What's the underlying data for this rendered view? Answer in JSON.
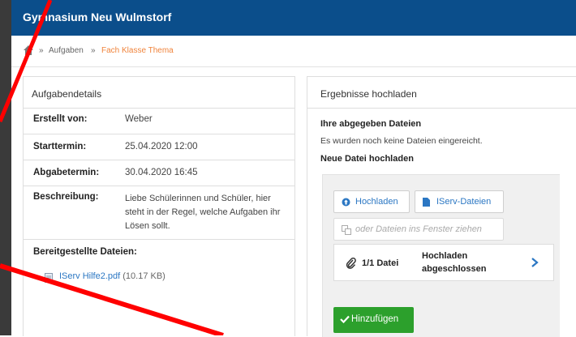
{
  "app": {
    "title": "Gymnasium Neu Wulmstorf"
  },
  "breadcrumb": {
    "sep1": "»",
    "item1": "Aufgaben",
    "sep2": "»",
    "current": "Fach Klasse Thema"
  },
  "details": {
    "heading": "Aufgabendetails",
    "rows": [
      {
        "label": "Erstellt von:",
        "value": "Weber"
      },
      {
        "label": "Starttermin:",
        "value": "25.04.2020 12:00"
      },
      {
        "label": "Abgabetermin:",
        "value": "30.04.2020 16:45"
      },
      {
        "label": "Beschreibung:",
        "value": "Liebe Schülerinnen und Schüler, hier steht in der Regel, welche Aufgaben ihr Lösen sollt."
      }
    ],
    "files_label": "Bereitgestellte Dateien:",
    "file_name": "IServ Hilfe2.pdf",
    "file_size": "(10.17 KB)"
  },
  "upload": {
    "heading": "Ergebnisse hochladen",
    "submitted_label": "Ihre abgegeben Dateien",
    "submitted_text": "Es wurden noch keine Dateien eingereicht.",
    "new_label": "Neue Datei hochladen",
    "btn_upload": "Hochladen",
    "btn_iserv": "IServ-Dateien",
    "drop_text": "oder Dateien ins Fenster ziehen",
    "status_count": "1/1 Datei",
    "status_text": "Hochladen abgeschlossen",
    "add_button": "Hinzufügen"
  },
  "colors": {
    "topbar": "#0b4e8b",
    "accent_orange": "#f0843c",
    "link_blue": "#2b77c3",
    "add_green": "#2ca02c",
    "annotation_red": "#ff0000"
  },
  "icons": [
    "home-icon",
    "pdf-file-icon",
    "upload-circle-icon",
    "file-icon",
    "drag-copy-icon",
    "paperclip-icon",
    "chevron-right-icon",
    "check-icon"
  ]
}
